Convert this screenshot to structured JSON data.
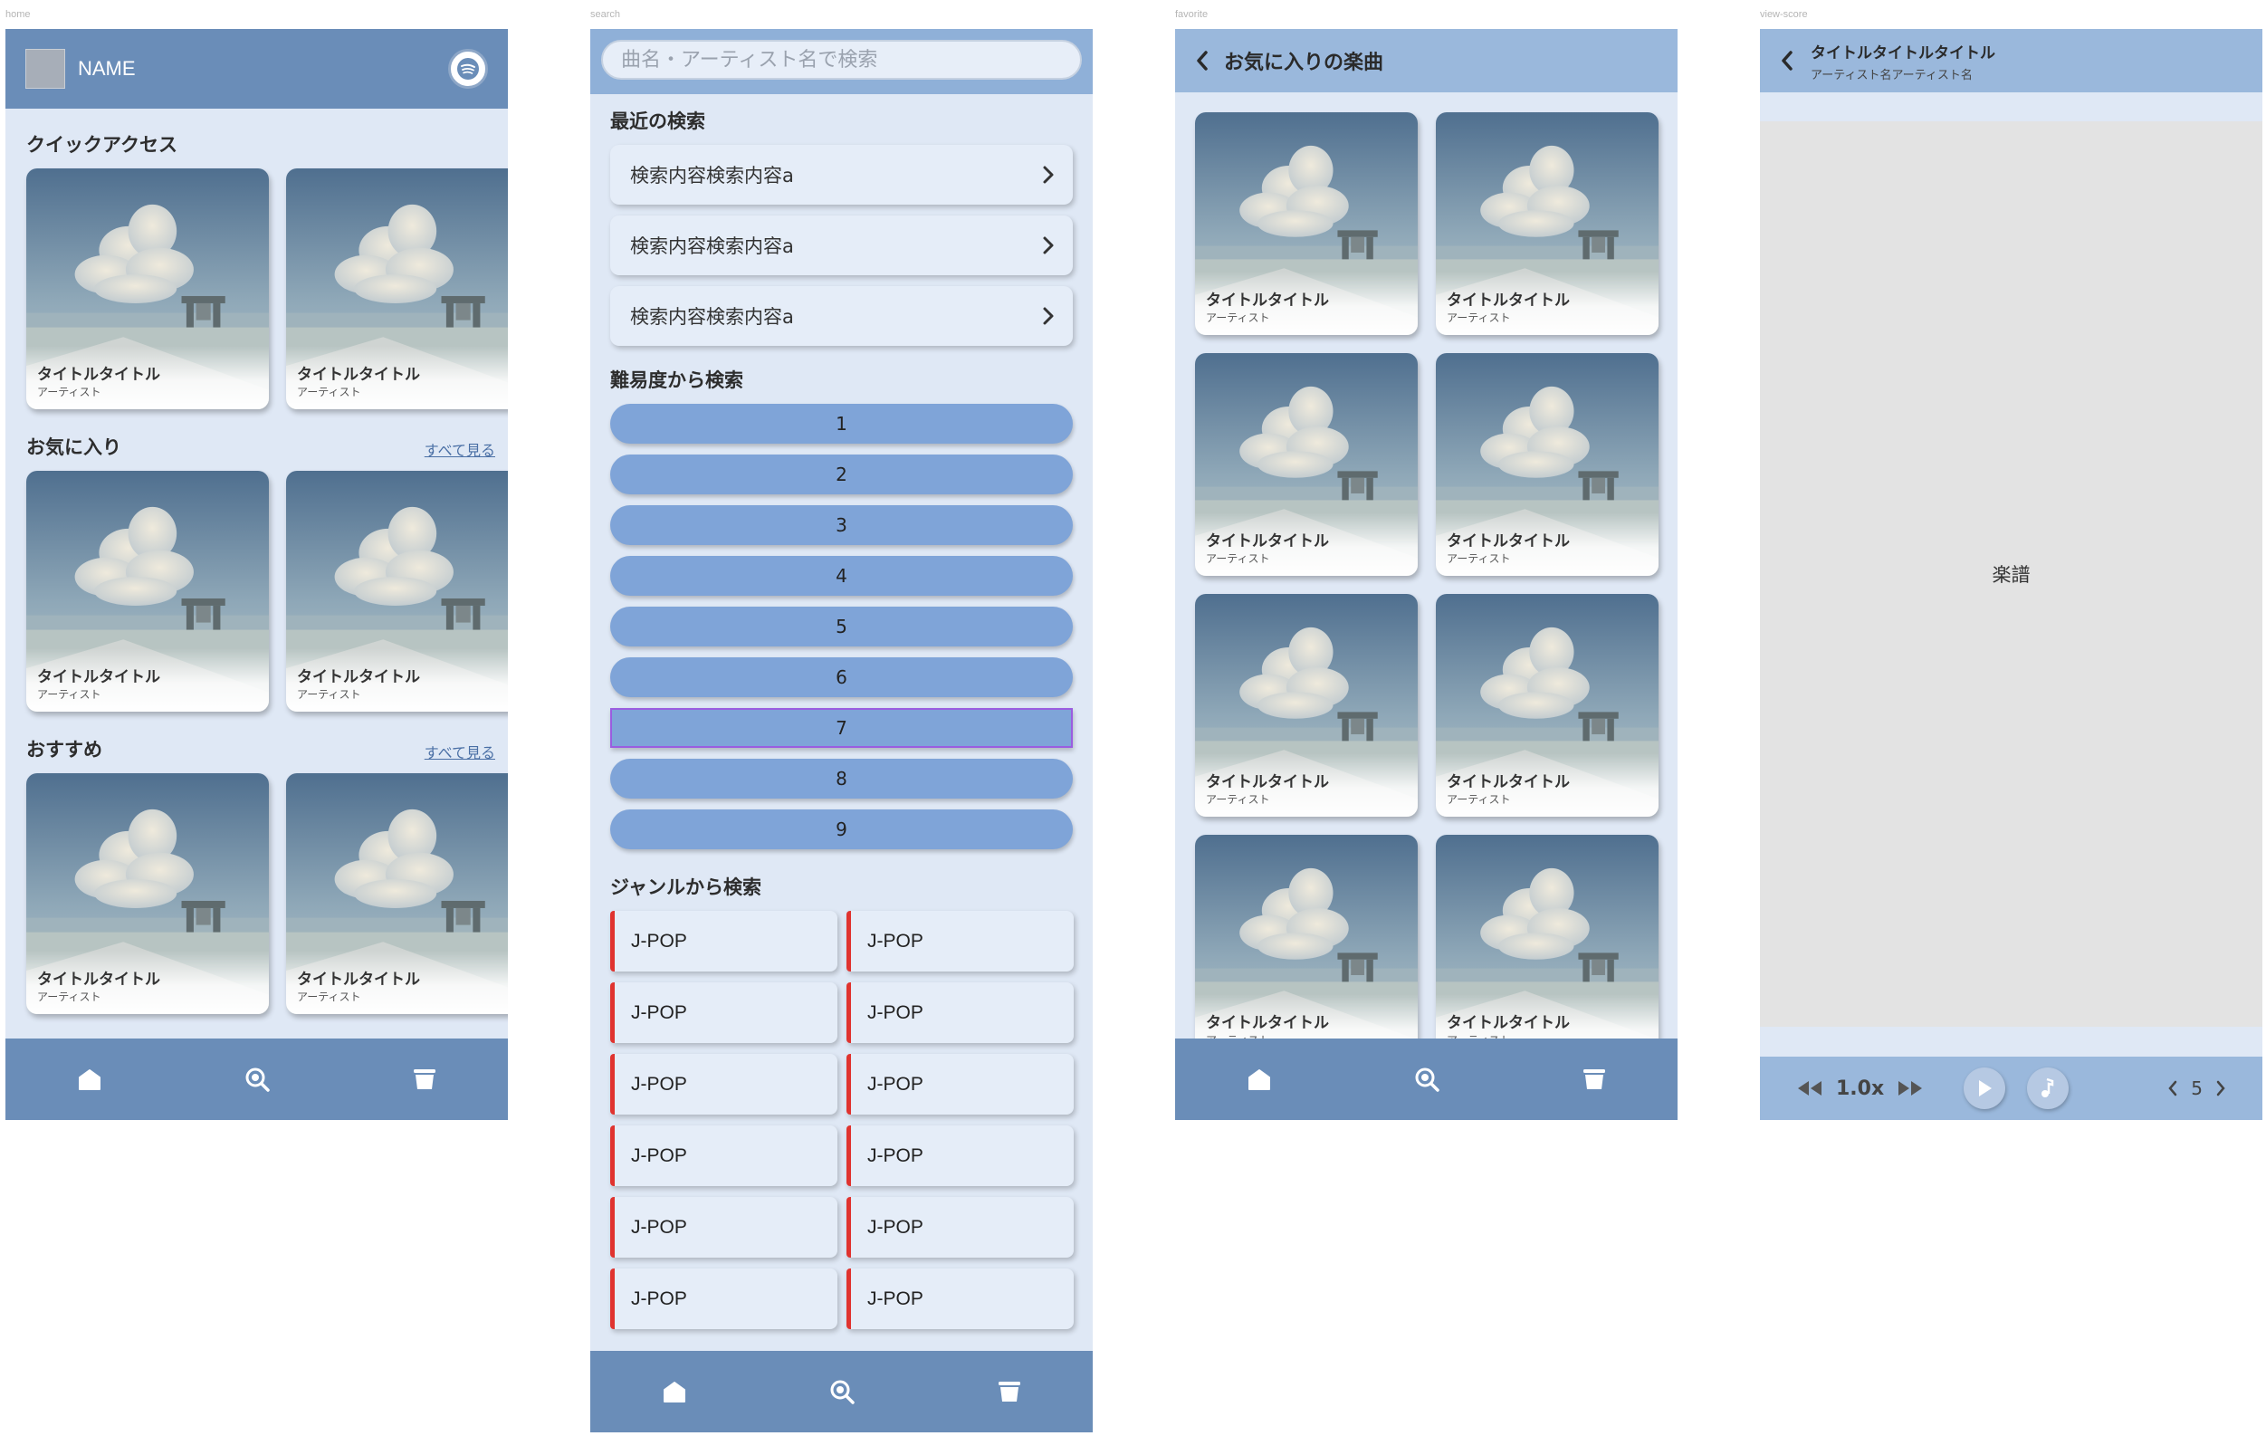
{
  "frames": {
    "home": "home",
    "search": "search",
    "favorite": "favorite",
    "view_score": "view-score"
  },
  "colors": {
    "header": "#6a8db8",
    "background": "#dfe8f5",
    "difficulty_button": "#7fa4d8",
    "genre_accent": "#e0332f"
  },
  "home": {
    "user_name": "NAME",
    "service_icon": "spotify-icon",
    "sections": [
      {
        "title": "クイックアクセス",
        "see_all": "",
        "cards": [
          {
            "title": "タイトルタイトル",
            "artist": "アーティスト"
          },
          {
            "title": "タイトルタイトル",
            "artist": "アーティスト"
          }
        ]
      },
      {
        "title": "お気に入り",
        "see_all": "すべて見る",
        "cards": [
          {
            "title": "タイトルタイトル",
            "artist": "アーティスト"
          },
          {
            "title": "タイトルタイトル",
            "artist": "アーティスト"
          }
        ]
      },
      {
        "title": "おすすめ",
        "see_all": "すべて見る",
        "cards": [
          {
            "title": "タイトルタイトル",
            "artist": "アーティスト"
          },
          {
            "title": "タイトルタイトル",
            "artist": "アーティスト"
          }
        ]
      }
    ]
  },
  "nav": [
    "home-icon",
    "search-icon",
    "library-icon"
  ],
  "search": {
    "placeholder": "曲名・アーティスト名で検索",
    "recent_title": "最近の検索",
    "recent": [
      "検索内容検索内容a",
      "検索内容検索内容a",
      "検索内容検索内容a"
    ],
    "difficulty_title": "難易度から検索",
    "difficulties": [
      "1",
      "2",
      "3",
      "4",
      "5",
      "6",
      "7",
      "8",
      "9"
    ],
    "selected_difficulty": "7",
    "genre_title": "ジャンルから検索",
    "genres": [
      "J-POP",
      "J-POP",
      "J-POP",
      "J-POP",
      "J-POP",
      "J-POP",
      "J-POP",
      "J-POP",
      "J-POP",
      "J-POP",
      "J-POP",
      "J-POP"
    ]
  },
  "favorite": {
    "title": "お気に入りの楽曲",
    "cards": [
      {
        "title": "タイトルタイトル",
        "artist": "アーティスト"
      },
      {
        "title": "タイトルタイトル",
        "artist": "アーティスト"
      },
      {
        "title": "タイトルタイトル",
        "artist": "アーティスト"
      },
      {
        "title": "タイトルタイトル",
        "artist": "アーティスト"
      },
      {
        "title": "タイトルタイトル",
        "artist": "アーティスト"
      },
      {
        "title": "タイトルタイトル",
        "artist": "アーティスト"
      },
      {
        "title": "タイトルタイトル",
        "artist": "アーティスト"
      },
      {
        "title": "タイトルタイトル",
        "artist": "アーティスト"
      }
    ]
  },
  "view_score": {
    "title": "タイトルタイトルタイトル",
    "artist": "アーティスト名アーティスト名",
    "score_placeholder": "楽譜",
    "speed": "1.0x",
    "page": "5"
  }
}
